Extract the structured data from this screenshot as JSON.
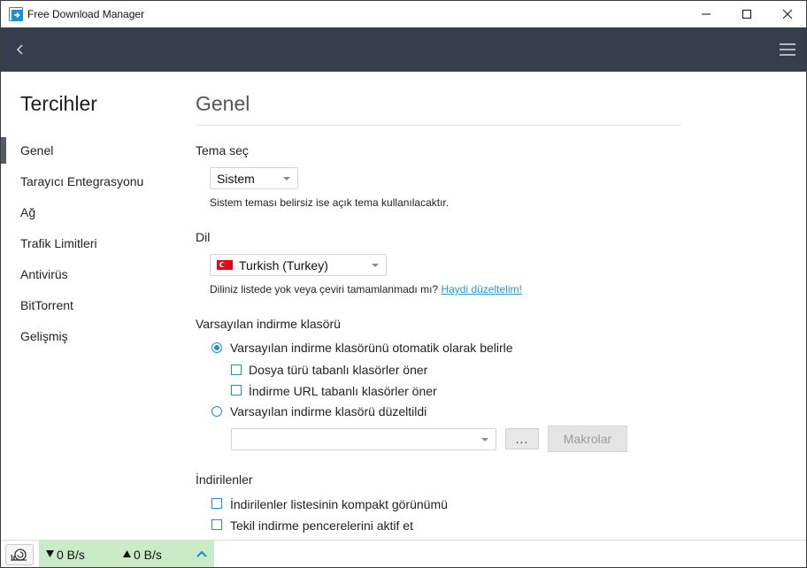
{
  "window": {
    "title": "Free Download Manager"
  },
  "sidebar": {
    "title": "Tercihler",
    "items": [
      {
        "label": "Genel",
        "active": true
      },
      {
        "label": "Tarayıcı Entegrasyonu"
      },
      {
        "label": "Ağ"
      },
      {
        "label": "Trafik Limitleri"
      },
      {
        "label": "Antivirüs"
      },
      {
        "label": "BitTorrent"
      },
      {
        "label": "Gelişmiş"
      }
    ]
  },
  "main": {
    "title": "Genel",
    "theme": {
      "label": "Tema seç",
      "value": "Sistem",
      "hint": "Sistem teması belirsiz ise açık tema kullanılacaktır."
    },
    "language": {
      "label": "Dil",
      "value": "Turkish (Turkey)",
      "flag_icon": "turkey-flag-icon",
      "hint": "Diliniz listede yok veya çeviri tamamlanmadı mı?",
      "link": "Haydi düzeltelim!"
    },
    "download_folder": {
      "label": "Varsayılan indirme klasörü",
      "radio_auto": "Varsayılan indirme klasörünü otomatik olarak belirle",
      "radio_auto_selected": true,
      "check_filetype": "Dosya türü tabanlı klasörler öner",
      "check_filetype_checked": false,
      "check_url": "İndirme URL tabanlı klasörler öner",
      "check_url_checked": false,
      "radio_fixed": "Varsayılan indirme klasörü düzeltildi",
      "radio_fixed_selected": false,
      "folder_path": "",
      "browse_label": "...",
      "macros_label": "Makrolar"
    },
    "downloads": {
      "label": "İndirilenler",
      "check_compact": "İndirilenler listesinin kompakt görünümü",
      "check_compact_checked": false,
      "check_single": "Tekil indirme pencerelerini aktif et",
      "check_single_checked": false
    }
  },
  "status": {
    "download_speed": "0 B/s",
    "upload_speed": "0 B/s"
  },
  "colors": {
    "navbar": "#363d4c",
    "accent": "#1d8fce",
    "link": "#1e9ad6",
    "speed_bg": "#c9ebc5"
  }
}
